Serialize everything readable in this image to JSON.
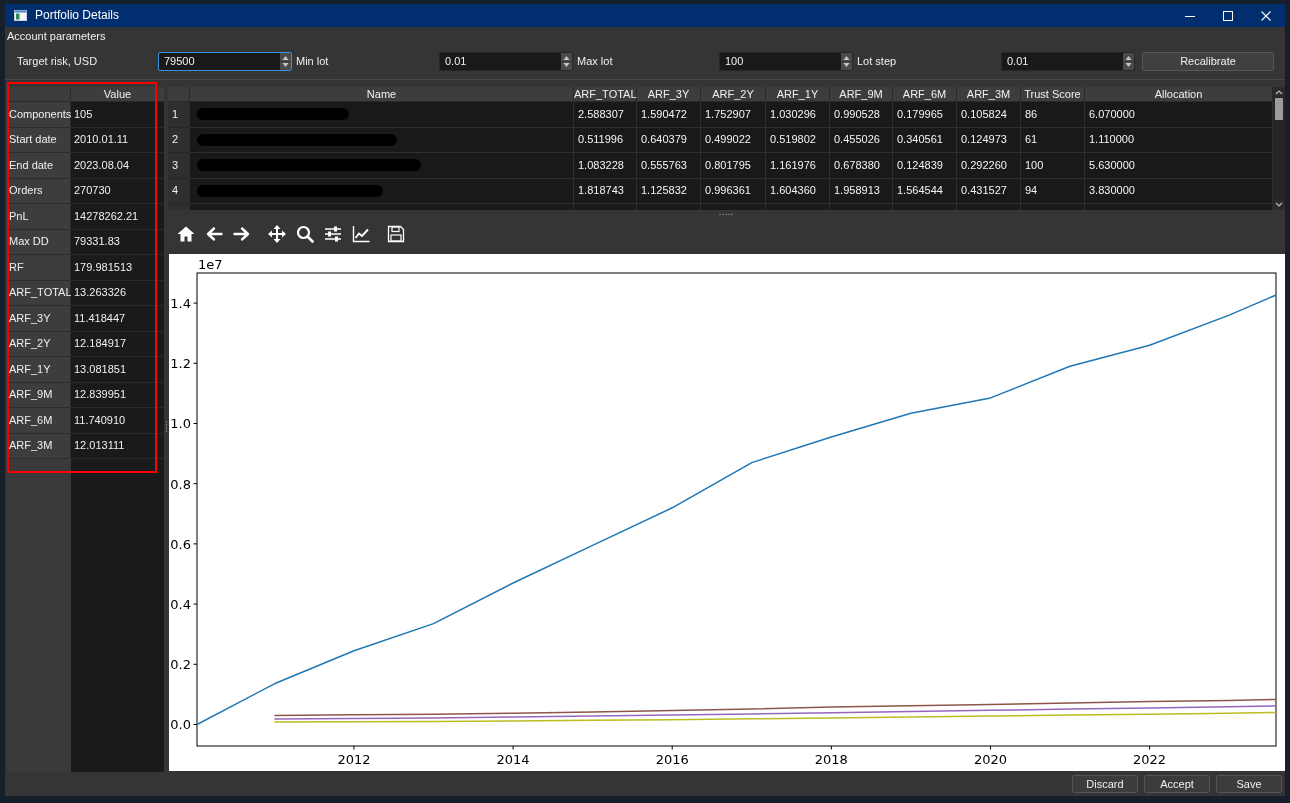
{
  "window": {
    "title": "Portfolio Details"
  },
  "account_parameters": {
    "title": "Account parameters",
    "fields": [
      {
        "label": "Target risk, USD",
        "value": "79500",
        "focused": true
      },
      {
        "label": "Min lot",
        "value": "0.01",
        "focused": false
      },
      {
        "label": "Max lot",
        "value": "100",
        "focused": false
      },
      {
        "label": "Lot step",
        "value": "0.01",
        "focused": false
      }
    ],
    "recalibrate_button": "Recalibrate"
  },
  "summary": {
    "highlighted": true,
    "header": "Value",
    "rows": [
      {
        "label": "Components",
        "value": "105"
      },
      {
        "label": "Start date",
        "value": "2010.01.11"
      },
      {
        "label": "End date",
        "value": "2023.08.04"
      },
      {
        "label": "Orders",
        "value": "270730"
      },
      {
        "label": "PnL",
        "value": "14278262.21"
      },
      {
        "label": "Max DD",
        "value": "79331.83"
      },
      {
        "label": "RF",
        "value": "179.981513"
      },
      {
        "label": "ARF_TOTAL",
        "value": "13.263326"
      },
      {
        "label": "ARF_3Y",
        "value": "11.418447"
      },
      {
        "label": "ARF_2Y",
        "value": "12.184917"
      },
      {
        "label": "ARF_1Y",
        "value": "13.081851"
      },
      {
        "label": "ARF_9M",
        "value": "12.839951"
      },
      {
        "label": "ARF_6M",
        "value": "11.740910"
      },
      {
        "label": "ARF_3M",
        "value": "12.013111"
      }
    ]
  },
  "components_table": {
    "columns": [
      "Name",
      "ARF_TOTAL",
      "ARF_3Y",
      "ARF_2Y",
      "ARF_1Y",
      "ARF_9M",
      "ARF_6M",
      "ARF_3M",
      "Trust Score",
      "Allocation"
    ],
    "rows": [
      {
        "index": "1",
        "redacted": true,
        "cells": [
          "",
          "2.588307",
          "1.590472",
          "1.752907",
          "1.030296",
          "0.990528",
          "0.179965",
          "0.105824",
          "86",
          "6.070000"
        ]
      },
      {
        "index": "2",
        "redacted": true,
        "cells": [
          "",
          "0.511996",
          "0.640379",
          "0.499022",
          "0.519802",
          "0.455026",
          "0.340561",
          "0.124973",
          "61",
          "1.110000"
        ]
      },
      {
        "index": "3",
        "redacted": true,
        "cells": [
          "",
          "1.083228",
          "0.555763",
          "0.801795",
          "1.161976",
          "0.678380",
          "0.124839",
          "0.292260",
          "100",
          "5.630000"
        ]
      },
      {
        "index": "4",
        "redacted": true,
        "cells": [
          "",
          "1.818743",
          "1.125832",
          "0.996361",
          "1.604360",
          "1.958913",
          "1.564544",
          "0.431527",
          "94",
          "3.830000"
        ]
      }
    ]
  },
  "plot": {
    "chart_data": [
      {
        "type": "line",
        "x": [
          "2010-01-11",
          "2011-01-01",
          "2012-01-01",
          "2013-01-01",
          "2014-01-01",
          "2015-01-01",
          "2016-01-01",
          "2017-01-01",
          "2018-01-01",
          "2019-01-01",
          "2020-01-01",
          "2021-01-01",
          "2022-01-01",
          "2023-01-01",
          "2023-08-04"
        ],
        "xlim": [
          "2010-01-11",
          "2023-08-04"
        ],
        "ylim": [
          -0.0715,
          1.5
        ],
        "xticks": [
          {
            "value": "2012-01-01",
            "label": "2012"
          },
          {
            "value": "2014-01-01",
            "label": "2014"
          },
          {
            "value": "2016-01-01",
            "label": "2016"
          },
          {
            "value": "2018-01-01",
            "label": "2018"
          },
          {
            "value": "2020-01-01",
            "label": "2020"
          },
          {
            "value": "2022-01-01",
            "label": "2022"
          }
        ],
        "yticks": [
          {
            "value": 0,
            "label": "0.0"
          },
          {
            "value": 0.2,
            "label": "0.2"
          },
          {
            "value": 0.4,
            "label": "0.4"
          },
          {
            "value": 0.6,
            "label": "0.6"
          },
          {
            "value": 0.8,
            "label": "0.8"
          },
          {
            "value": 1.0,
            "label": "1.0"
          },
          {
            "value": 1.2,
            "label": "1.2"
          },
          {
            "value": 1.4,
            "label": "1.4"
          }
        ],
        "annotations": [
          "1e7"
        ],
        "series": [
          {
            "color": "#1f77b4",
            "values": [
              0,
              0.135,
              0.245,
              0.335,
              0.47,
              0.595,
              0.72,
              0.87,
              0.955,
              1.034,
              1.085,
              1.19,
              1.26,
              1.36,
              1.427
            ]
          },
          {
            "color": "#8c564b",
            "values": [
              null,
              0.03,
              0.032,
              0.034,
              0.037,
              0.041,
              0.046,
              0.051,
              0.058,
              0.062,
              0.066,
              0.071,
              0.076,
              0.08,
              0.083
            ]
          },
          {
            "color": "#9467bd",
            "values": [
              null,
              0.018,
              0.02,
              0.022,
              0.025,
              0.028,
              0.031,
              0.035,
              0.039,
              0.043,
              0.047,
              0.051,
              0.055,
              0.059,
              0.062
            ]
          },
          {
            "color": "#bcbd22",
            "values": [
              null,
              0.008,
              0.009,
              0.01,
              0.012,
              0.014,
              0.016,
              0.019,
              0.022,
              0.025,
              0.028,
              0.031,
              0.034,
              0.037,
              0.04
            ]
          }
        ]
      }
    ]
  },
  "buttons": [
    "Discard",
    "Accept",
    "Save"
  ]
}
